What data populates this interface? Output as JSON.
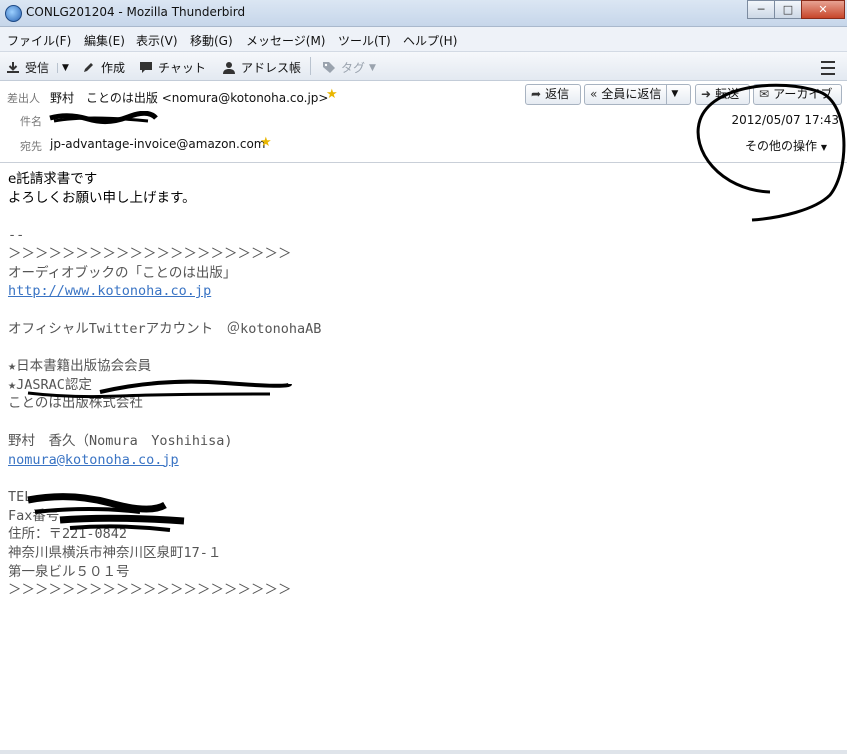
{
  "window": {
    "title": "CONLG201204 - Mozilla Thunderbird"
  },
  "window_controls": {
    "minimize": "─",
    "maximize": "□",
    "close": "✕"
  },
  "menu": [
    "ファイル(F)",
    "編集(E)",
    "表示(V)",
    "移動(G)",
    "メッセージ(M)",
    "ツール(T)",
    "ヘルプ(H)"
  ],
  "toolbar": {
    "receive": "受信",
    "compose": "作成",
    "chat": "チャット",
    "address_book": "アドレス帳",
    "tag": "タグ"
  },
  "message": {
    "from_label": "差出人",
    "from_value": "野村　ことのは出版 <nomura@kotonoha.co.jp>",
    "subject_label": "件名",
    "to_label": "宛先",
    "to_value": "jp-advantage-invoice@amazon.com",
    "date": "2012/05/07 17:43",
    "other_actions": "その他の操作",
    "buttons": {
      "reply": "返信",
      "reply_all": "全員に返信",
      "forward": "転送",
      "archive": "アーカイブ"
    }
  },
  "body": {
    "line1": "e託請求書です",
    "line2": "よろしくお願い申し上げます。",
    "sig_dash": "--",
    "sig_rule": "＞＞＞＞＞＞＞＞＞＞＞＞＞＞＞＞＞＞＞＞＞",
    "sig_name": "オーディオブックの「ことのは出版」",
    "sig_url": "http://www.kotonoha.co.jp",
    "sig_twitter": "オフィシャルTwitterアカウント　＠kotonohaAB",
    "sig_member": "★日本書籍出版協会会員",
    "sig_jasrac": "★JASRAC認定",
    "sig_company": "ことのは出版株式会社",
    "sig_person": "野村　香久（Nomura　Yoshihisa)",
    "sig_email": "nomura@kotonoha.co.jp",
    "sig_tel": "TEL",
    "sig_fax": "Fax番号",
    "sig_zip": "住所：〒221-0842",
    "sig_addr1": "神奈川県横浜市神奈川区泉町17-１",
    "sig_addr2": "第一泉ビル５０１号",
    "sig_rule2": "＞＞＞＞＞＞＞＞＞＞＞＞＞＞＞＞＞＞＞＞＞"
  },
  "colors": {
    "link": "#3a74c4",
    "star": "#e9b600",
    "body_text": "#555555"
  }
}
